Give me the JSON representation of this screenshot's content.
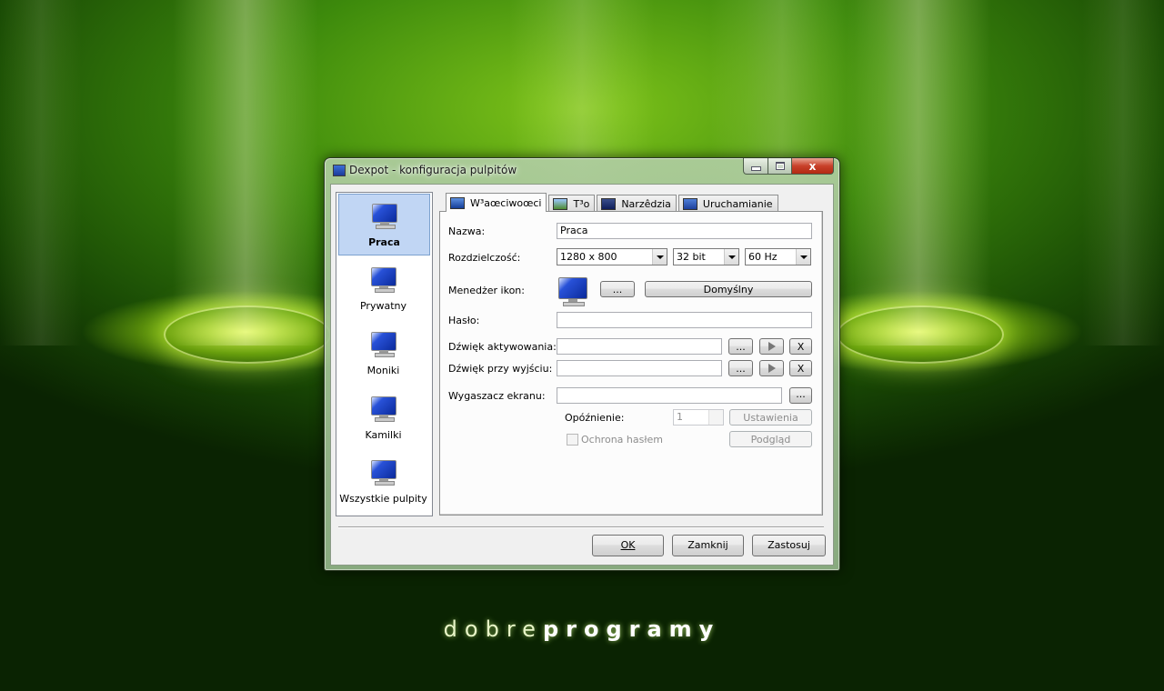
{
  "window": {
    "title": "Dexpot - konfiguracja pulpitów",
    "caption_buttons": {
      "minimize_icon": "minimize-icon",
      "maximize_icon": "maximize-icon",
      "close_label": "x"
    }
  },
  "profiles": [
    {
      "label": "Praca",
      "icon": "monitor-icon",
      "selected": true
    },
    {
      "label": "Prywatny",
      "icon": "monitor-icon",
      "selected": false
    },
    {
      "label": "Moniki",
      "icon": "monitor-icon",
      "selected": false
    },
    {
      "label": "Kamilki",
      "icon": "monitor-icon",
      "selected": false
    },
    {
      "label": "Wszystkie pulpity",
      "icon": "monitor-icon",
      "selected": false
    }
  ],
  "tabs": [
    {
      "label": "W³aœciwoœci",
      "icon": "properties-tab-icon",
      "active": true
    },
    {
      "label": "T³o",
      "icon": "wallpaper-tab-icon",
      "active": false
    },
    {
      "label": "Narzêdzia",
      "icon": "tools-tab-icon",
      "active": false
    },
    {
      "label": "Uruchamianie",
      "icon": "startup-tab-icon",
      "active": false
    }
  ],
  "form": {
    "name_label": "Nazwa:",
    "name_value": "Praca",
    "resolution_label": "Rozdzielczość:",
    "resolution_value": "1280 x 800",
    "depth_value": "32 bit",
    "refresh_value": "60 Hz",
    "icon_manager_label": "Menedżer ikon:",
    "browse_label": "...",
    "default_label": "Domyślny",
    "password_label": "Hasło:",
    "password_value": "",
    "sound_activate_label": "Dźwięk aktywowania:",
    "sound_activate_value": "",
    "sound_exit_label": "Dźwięk przy wyjściu:",
    "sound_exit_value": "",
    "clear_label": "X",
    "screensaver_label": "Wygaszacz ekranu:",
    "screensaver_value": "",
    "delay_label": "Opóźnienie:",
    "delay_value": "1",
    "settings_label": "Ustawienia",
    "password_protect_label": "Ochrona hasłem",
    "password_protect_checked": false,
    "preview_label": "Podgląd"
  },
  "footer": {
    "ok_label": "OK",
    "close_label": "Zamknij",
    "apply_label": "Zastosuj"
  },
  "watermark": {
    "light": "dobre",
    "bold": "programy"
  }
}
